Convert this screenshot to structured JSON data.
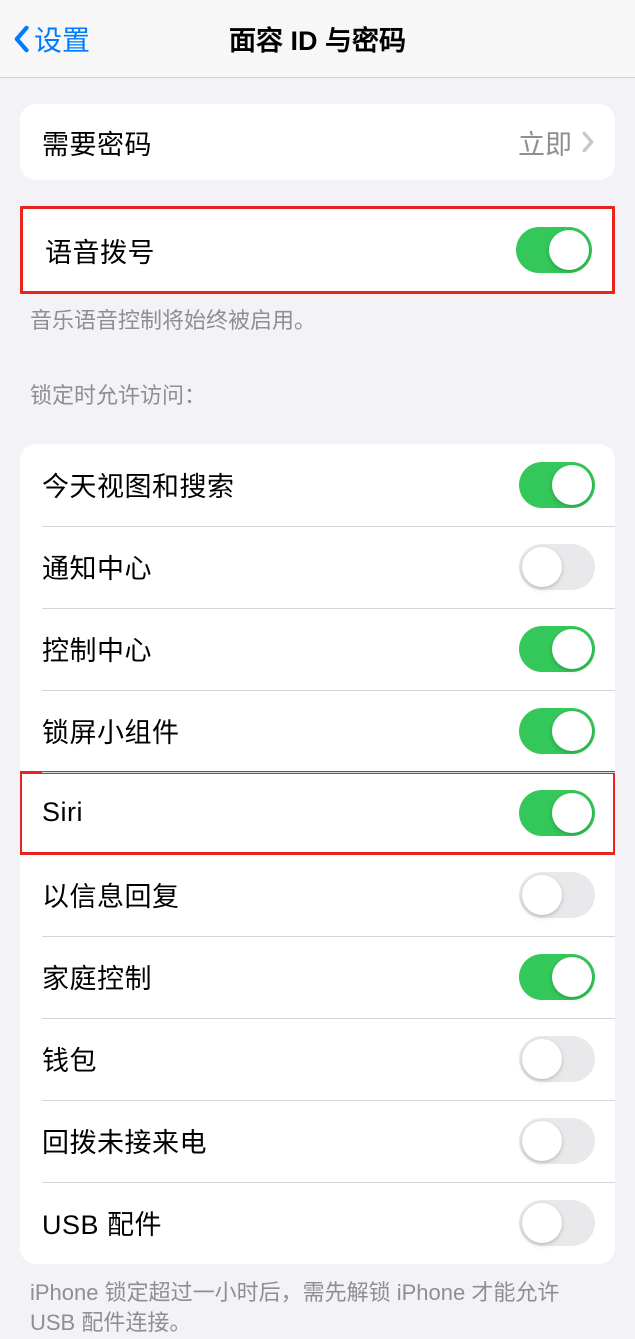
{
  "nav": {
    "back_label": "设置",
    "title": "面容 ID 与密码"
  },
  "require_passcode": {
    "label": "需要密码",
    "value": "立即"
  },
  "voice_dial": {
    "label": "语音拨号",
    "enabled": true,
    "caption": "音乐语音控制将始终被启用。"
  },
  "lock_access": {
    "header": "锁定时允许访问：",
    "items": [
      {
        "label": "今天视图和搜索",
        "enabled": true
      },
      {
        "label": "通知中心",
        "enabled": false
      },
      {
        "label": "控制中心",
        "enabled": true
      },
      {
        "label": "锁屏小组件",
        "enabled": true
      },
      {
        "label": "Siri",
        "enabled": true
      },
      {
        "label": "以信息回复",
        "enabled": false
      },
      {
        "label": "家庭控制",
        "enabled": true
      },
      {
        "label": "钱包",
        "enabled": false
      },
      {
        "label": "回拨未接来电",
        "enabled": false
      },
      {
        "label": "USB 配件",
        "enabled": false
      }
    ],
    "footer": "iPhone 锁定超过一小时后，需先解锁 iPhone 才能允许 USB 配件连接。"
  }
}
